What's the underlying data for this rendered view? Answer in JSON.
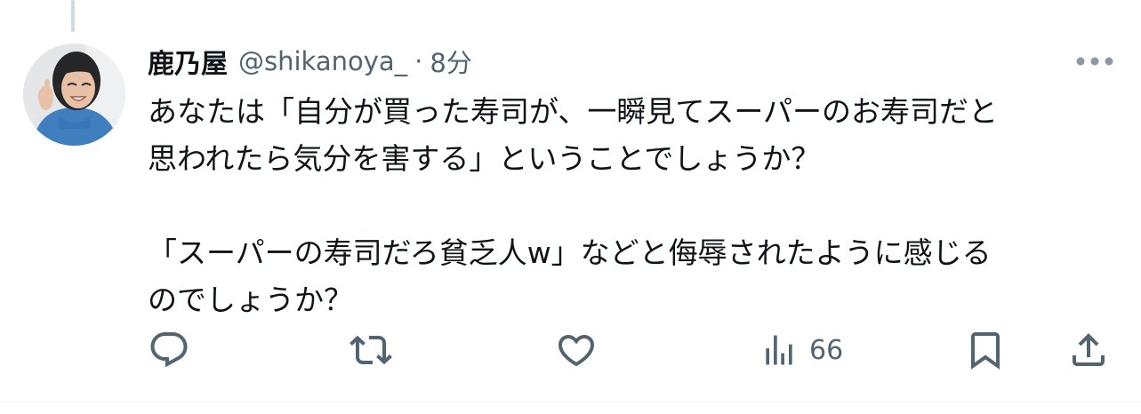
{
  "tweet": {
    "author": {
      "display_name": "鹿乃屋",
      "handle": "@shikanoya_",
      "avatar": "avatar-photo"
    },
    "separator": "·",
    "timestamp": "8分",
    "text": "あなたは「自分が買った寿司が、一瞬見てスーパーのお寿司だと\n思われたら気分を害する」ということでしょうか？\n\n「スーパーの寿司だろ貧乏人w」などと侮辱されたように感じる\nのでしょうか？",
    "more_icon": "more-horizontal-icon",
    "actions": {
      "reply_icon": "reply-icon",
      "retweet_icon": "retweet-icon",
      "like_icon": "like-icon",
      "views_icon": "views-icon",
      "views_count": "66",
      "bookmark_icon": "bookmark-icon",
      "share_icon": "share-icon"
    }
  },
  "colors": {
    "text_primary": "#0f1419",
    "text_secondary": "#536471",
    "thread_line": "#cfd9de"
  }
}
